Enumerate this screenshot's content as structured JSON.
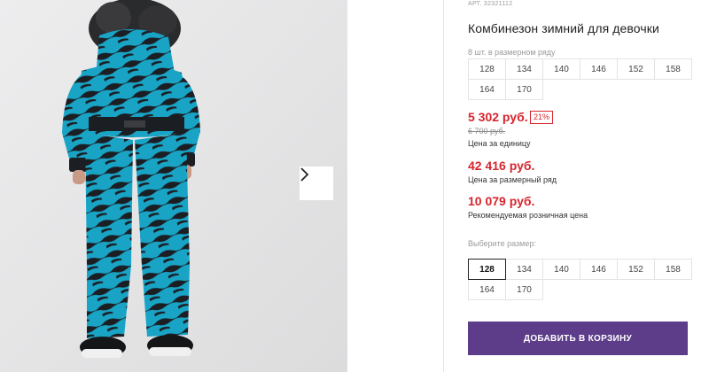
{
  "product": {
    "article": "АРТ. 32321112",
    "title": "Комбинезон зимний для девочки"
  },
  "size_row": {
    "hint": "8 шт. в размерном ряду",
    "sizes": [
      "128",
      "134",
      "140",
      "146",
      "152",
      "158",
      "164",
      "170"
    ]
  },
  "pricing": {
    "unit_price": "5 302 руб.",
    "discount": "21%",
    "old_price": "6 700 руб.",
    "unit_caption": "Цена за единицу",
    "row_price": "42 416 руб.",
    "row_caption": "Цена за размерный ряд",
    "retail_price": "10 079 руб.",
    "retail_caption": "Рекомендуемая розничная цена"
  },
  "size_select": {
    "hint": "Выберите размер:",
    "sizes": [
      "128",
      "134",
      "140",
      "146",
      "152",
      "158",
      "164",
      "170"
    ],
    "selected": "128"
  },
  "cart": {
    "add_label": "ДОБАВИТЬ В КОРЗИНУ"
  },
  "gallery": {
    "next_icon": "chevron-right-icon"
  },
  "colors": {
    "price_red": "#d6262e",
    "button_purple": "#5d3d8a",
    "jumpsuit_blue": "#1aa6c8"
  }
}
